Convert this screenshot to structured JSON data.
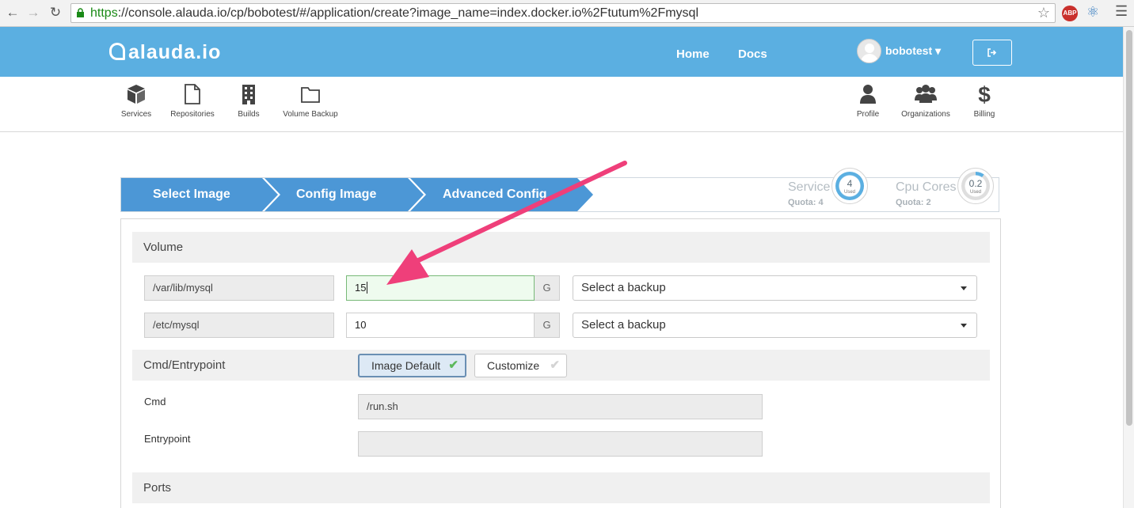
{
  "browser": {
    "url_scheme": "https",
    "url_rest": "://console.alauda.io/cp/bobotest/#/application/create?image_name=index.docker.io%2Ftutum%2Fmysql",
    "abp_label": "ABP"
  },
  "header": {
    "logo_text": "alauda.io",
    "nav": [
      "Home",
      "Docs"
    ],
    "username": "bobotest",
    "caret": "▾",
    "logout_icon": "sign-out-icon"
  },
  "icon_nav": {
    "left": [
      {
        "label": "Services",
        "icon": "cube-icon"
      },
      {
        "label": "Repositories",
        "icon": "file-icon"
      },
      {
        "label": "Builds",
        "icon": "building-icon"
      },
      {
        "label": "Volume Backup",
        "icon": "folder-icon"
      }
    ],
    "right": [
      {
        "label": "Profile",
        "icon": "user-icon"
      },
      {
        "label": "Organizations",
        "icon": "users-icon"
      },
      {
        "label": "Billing",
        "icon": "dollar-icon"
      }
    ]
  },
  "wizard": {
    "steps": [
      "Select Image",
      "Config Image",
      "Advanced Config"
    ],
    "quotas": [
      {
        "label": "Service",
        "quota_text": "Quota:  4",
        "used_value": "4",
        "used_label": "Used",
        "used_fraction": 1.0
      },
      {
        "label": "Cpu Cores",
        "quota_text": "Quota:  2",
        "used_value": "0.2",
        "used_label": "Used",
        "used_fraction": 0.1
      }
    ],
    "colors": {
      "step": "#4c97d6",
      "ring": "#5bafe1"
    }
  },
  "volume": {
    "title": "Volume",
    "rows": [
      {
        "path": "/var/lib/mysql",
        "size": "15",
        "unit": "G",
        "backup_placeholder": "Select a backup"
      },
      {
        "path": "/etc/mysql",
        "size": "10",
        "unit": "G",
        "backup_placeholder": "Select a backup"
      }
    ]
  },
  "cmd_entrypoint": {
    "title": "Cmd/Entrypoint",
    "options": [
      "Image Default",
      "Customize"
    ],
    "check_glyph": "✔",
    "cmd_label": "Cmd",
    "cmd_value": "/run.sh",
    "entrypoint_label": "Entrypoint",
    "entrypoint_value": ""
  },
  "ports": {
    "title": "Ports"
  },
  "annotation": {
    "color": "#ef3f7a"
  }
}
